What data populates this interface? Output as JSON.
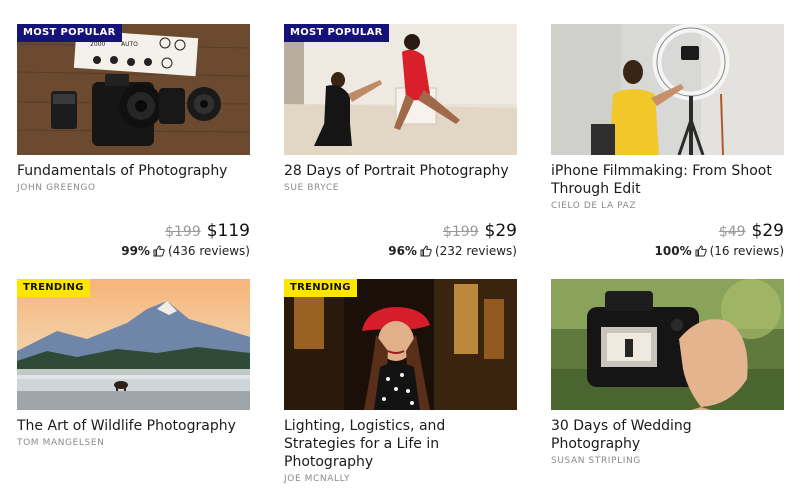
{
  "courses": [
    {
      "badge": "MOST POPULAR",
      "title": "Fundamentals of Photography",
      "author": "JOHN GREENGO",
      "original_price": "$199",
      "price": "$119",
      "rating_pct": "99%",
      "reviews": "(436 reviews)",
      "image": "camera-flatlay"
    },
    {
      "badge": "MOST POPULAR",
      "title": "28 Days of Portrait Photography",
      "author": "SUE BRYCE",
      "original_price": "$199",
      "price": "$29",
      "rating_pct": "96%",
      "reviews": "(232 reviews)",
      "image": "portrait-studio"
    },
    {
      "badge": "",
      "title": "iPhone Filmmaking: From Shoot Through Edit",
      "author": "CIELO DE LA PAZ",
      "original_price": "$49",
      "price": "$29",
      "rating_pct": "100%",
      "reviews": "(16 reviews)",
      "image": "ring-light"
    },
    {
      "badge": "TRENDING",
      "title": "The Art of Wildlife Photography",
      "author": "TOM MANGELSEN",
      "image": "mountain-wildlife"
    },
    {
      "badge": "TRENDING",
      "title": "Lighting, Logistics, and Strategies for a Life in Photography",
      "author": "JOE MCNALLY",
      "image": "red-beret-portrait"
    },
    {
      "badge": "",
      "title": "30 Days of Wedding Photography",
      "author": "SUSAN STRIPLING",
      "image": "camera-in-hand"
    }
  ],
  "colors": {
    "badge_popular_bg": "#15127a",
    "badge_trending_bg": "#ffe600",
    "strike_price": "#9a9a9a",
    "author_text": "#8a8a8a"
  },
  "icons": {
    "rating": "thumbs-up-icon"
  }
}
